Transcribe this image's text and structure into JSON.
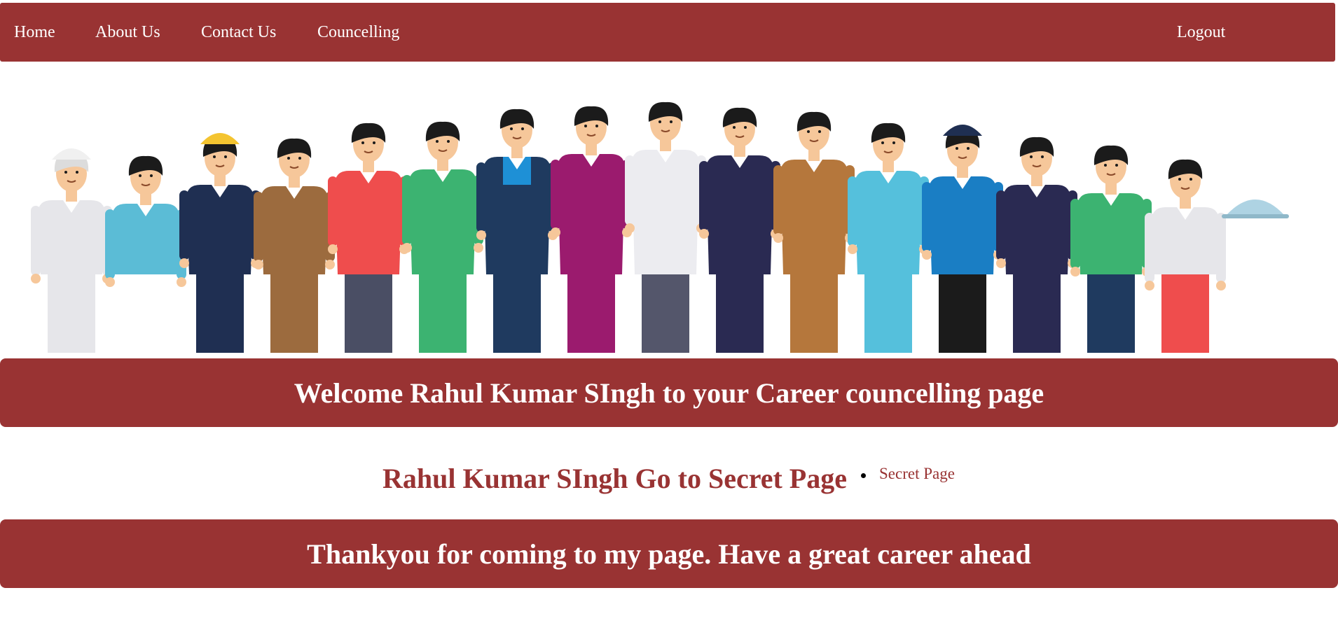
{
  "nav": {
    "home": "Home",
    "about": "About Us",
    "contact": "Contact Us",
    "councelling": "Councelling",
    "logout": "Logout"
  },
  "hero": {
    "image": "group-of-professionals-illustration"
  },
  "welcome_banner": {
    "text": "Welcome Rahul Kumar SIngh to your Career councelling page"
  },
  "secret_section": {
    "heading": "Rahul Kumar SIngh Go to Secret Page",
    "link_label": "Secret Page"
  },
  "footer_banner": {
    "text": "Thankyou for coming to my page. Have a great career ahead"
  },
  "colors": {
    "brand": "#993333",
    "text_on_brand": "#ffffff"
  }
}
